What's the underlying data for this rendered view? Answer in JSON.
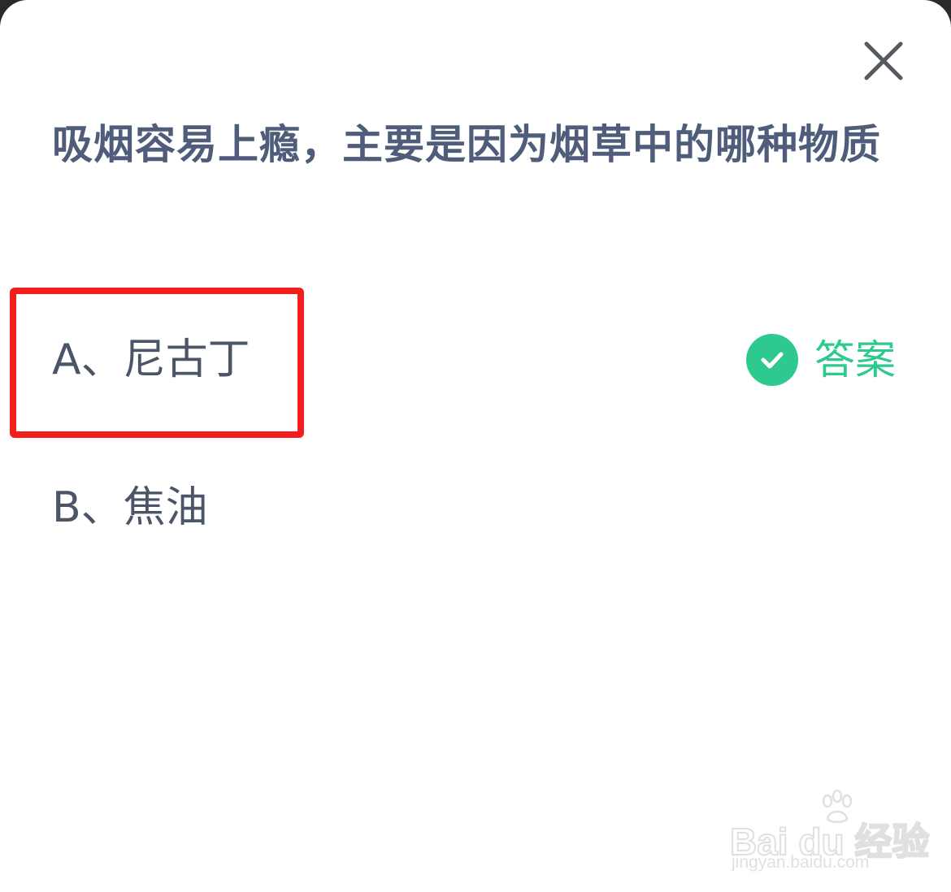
{
  "quiz": {
    "question": "吸烟容易上瘾，主要是因为烟草中的哪种物质",
    "options": [
      {
        "label": "A、尼古丁",
        "is_answer": true
      },
      {
        "label": "B、焦油",
        "is_answer": false
      }
    ],
    "answer_label": "答案"
  },
  "icons": {
    "close": "close-icon",
    "answer": "check-circle-icon",
    "watermark": "baidu-paw-icon"
  },
  "colors": {
    "question_text": "#4f5d7b",
    "option_text": "#4a5568",
    "answer_green": "#2ec98e",
    "highlight_red": "#f21e1e"
  },
  "watermark": {
    "brand": "Bai du 经验",
    "url": "jingyan.baidu.com"
  }
}
